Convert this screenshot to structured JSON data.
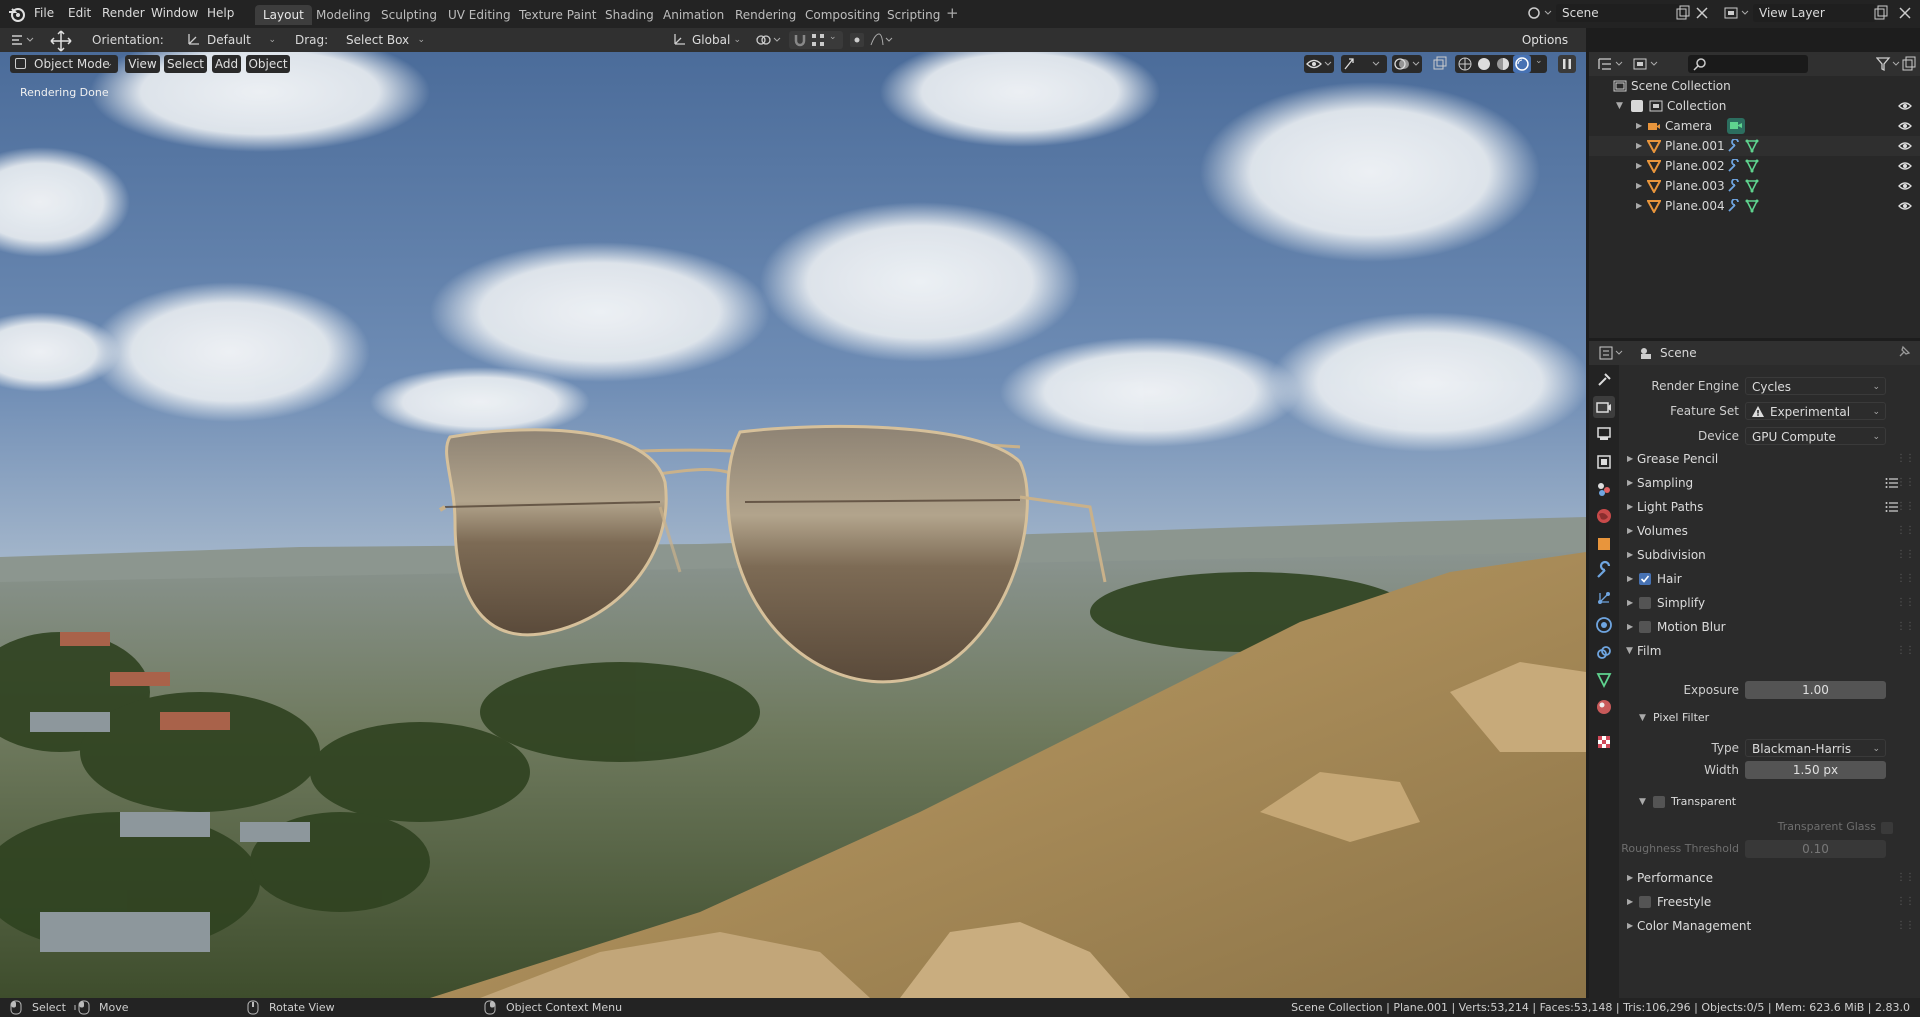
{
  "menu": [
    "File",
    "Edit",
    "Render",
    "Window",
    "Help"
  ],
  "workspaces": [
    "Layout",
    "Modeling",
    "Sculpting",
    "UV Editing",
    "Texture Paint",
    "Shading",
    "Animation",
    "Rendering",
    "Compositing",
    "Scripting"
  ],
  "add_workspace": "+",
  "scene": {
    "value": "Scene"
  },
  "view_layer": {
    "value": "View Layer"
  },
  "toolbar": {
    "orientation_label": "Orientation:",
    "orientation_value": "Default",
    "drag_label": "Drag:",
    "drag_value": "Select Box",
    "transform_value": "Global",
    "options_label": "Options"
  },
  "viewport": {
    "mode": "Object Mode",
    "view": "View",
    "select": "Select",
    "add": "Add",
    "object": "Object",
    "status_text": "Rendering Done"
  },
  "outliner": {
    "search_placeholder": "",
    "root": "Scene Collection",
    "collection": "Collection",
    "items": [
      {
        "name": "Camera",
        "type": "camera"
      },
      {
        "name": "Plane.001",
        "type": "mesh"
      },
      {
        "name": "Plane.002",
        "type": "mesh"
      },
      {
        "name": "Plane.003",
        "type": "mesh"
      },
      {
        "name": "Plane.004",
        "type": "mesh"
      }
    ]
  },
  "properties": {
    "context": "Scene",
    "render_engine_label": "Render Engine",
    "render_engine": "Cycles",
    "feature_set_label": "Feature Set",
    "feature_set": "Experimental",
    "device_label": "Device",
    "device": "GPU Compute",
    "panels": {
      "grease_pencil": "Grease Pencil",
      "sampling": "Sampling",
      "light_paths": "Light Paths",
      "volumes": "Volumes",
      "subdivision": "Subdivision",
      "hair": "Hair",
      "simplify": "Simplify",
      "motion_blur": "Motion Blur",
      "film": "Film",
      "performance": "Performance",
      "freestyle": "Freestyle",
      "color_management": "Color Management"
    },
    "checks": {
      "hair": true,
      "simplify": false,
      "motion_blur": false,
      "transparent": false,
      "freestyle": false,
      "transparent_glass": false
    },
    "film": {
      "exposure_label": "Exposure",
      "exposure": "1.00",
      "pixel_filter": "Pixel Filter",
      "type_label": "Type",
      "type": "Blackman-Harris",
      "width_label": "Width",
      "width": "1.50 px",
      "transparent": "Transparent",
      "transparent_glass": "Transparent Glass",
      "roughness_label": "Roughness Threshold",
      "roughness": "0.10"
    }
  },
  "statusbar": {
    "select": "Select",
    "move": "Move",
    "rotate": "Rotate View",
    "context_menu": "Object Context Menu",
    "stats": "Scene Collection | Plane.001 | Verts:53,214 | Faces:53,148 | Tris:106,296 | Objects:0/5 | Mem: 623.6 MiB | 2.83.0"
  },
  "colors": {
    "accent": "#4772b3",
    "header": "#232323",
    "panel": "#2b2b2b",
    "mesh_icon": "#e8953c",
    "modifier_icon": "#6fa5e0",
    "data_icon": "#5fd38f"
  }
}
